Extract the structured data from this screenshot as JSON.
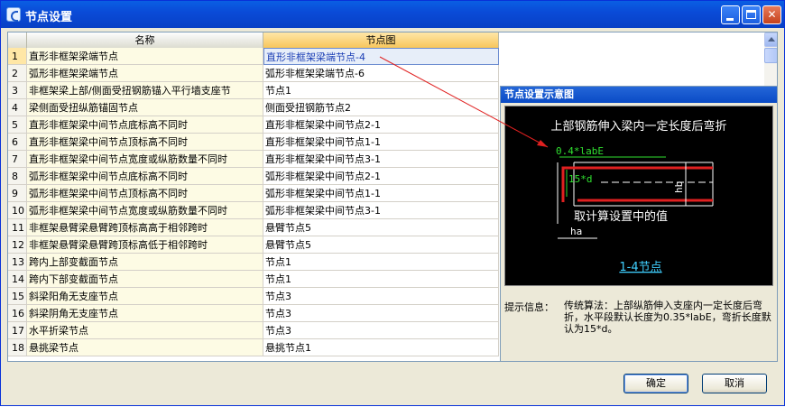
{
  "window": {
    "title": "节点设置"
  },
  "table": {
    "headers": {
      "name": "名称",
      "node": "节点图"
    },
    "rows": [
      {
        "num": "1",
        "name": "直形非框架梁端节点",
        "node": "直形非框架梁端节点-4"
      },
      {
        "num": "2",
        "name": "弧形非框架梁端节点",
        "node": "弧形非框架梁端节点-6"
      },
      {
        "num": "3",
        "name": "非框架梁上部/侧面受扭钢筋锚入平行墙支座节",
        "node": "节点1"
      },
      {
        "num": "4",
        "name": "梁侧面受扭纵筋锚固节点",
        "node": "侧面受扭钢筋节点2"
      },
      {
        "num": "5",
        "name": "直形非框架梁中间节点底标高不同时",
        "node": "直形非框架梁中间节点2-1"
      },
      {
        "num": "6",
        "name": "直形非框架梁中间节点顶标高不同时",
        "node": "直形非框架梁中间节点1-1"
      },
      {
        "num": "7",
        "name": "直形非框架梁中间节点宽度或纵筋数量不同时",
        "node": "直形非框架梁中间节点3-1"
      },
      {
        "num": "8",
        "name": "弧形非框架梁中间节点底标高不同时",
        "node": "弧形非框架梁中间节点2-1"
      },
      {
        "num": "9",
        "name": "弧形非框架梁中间节点顶标高不同时",
        "node": "弧形非框架梁中间节点1-1"
      },
      {
        "num": "10",
        "name": "弧形非框架梁中间节点宽度或纵筋数量不同时",
        "node": "弧形非框架梁中间节点3-1"
      },
      {
        "num": "11",
        "name": "非框架悬臂梁悬臂跨顶标高高于相邻跨时",
        "node": "悬臂节点5"
      },
      {
        "num": "12",
        "name": "非框架悬臂梁悬臂跨顶标高低于相邻跨时",
        "node": "悬臂节点5"
      },
      {
        "num": "13",
        "name": "跨内上部变截面节点",
        "node": "节点1"
      },
      {
        "num": "14",
        "name": "跨内下部变截面节点",
        "node": "节点1"
      },
      {
        "num": "15",
        "name": "斜梁阳角无支座节点",
        "node": "节点3"
      },
      {
        "num": "16",
        "name": "斜梁阴角无支座节点",
        "node": "节点3"
      },
      {
        "num": "17",
        "name": "水平折梁节点",
        "node": "节点3"
      },
      {
        "num": "18",
        "name": "悬挑梁节点",
        "node": "悬挑节点1"
      }
    ]
  },
  "preview": {
    "title": "节点设置示意图",
    "diagram": {
      "heading": "上部钢筋伸入梁内一定长度后弯折",
      "dim_top": "0.4*labE",
      "dim_left": "15*d",
      "dim_right": "hb",
      "note": "取计算设置中的值",
      "dim_bottom": "ha",
      "caption": "1-4节点"
    },
    "hint_label": "提示信息：",
    "hint_text": "传统算法：上部纵筋伸入支座内一定长度后弯折，水平段默认长度为0.35*labE，弯折长度默认为15*d。"
  },
  "buttons": {
    "ok": "确定",
    "cancel": "取消"
  },
  "colors": {
    "titlebar": "#0a4bd8",
    "selected_text": "#1c3fb5",
    "diagram_bg": "#000000",
    "rebar_red": "#e02020",
    "dim_green": "#30e030",
    "caption_cyan": "#40d0ff"
  }
}
